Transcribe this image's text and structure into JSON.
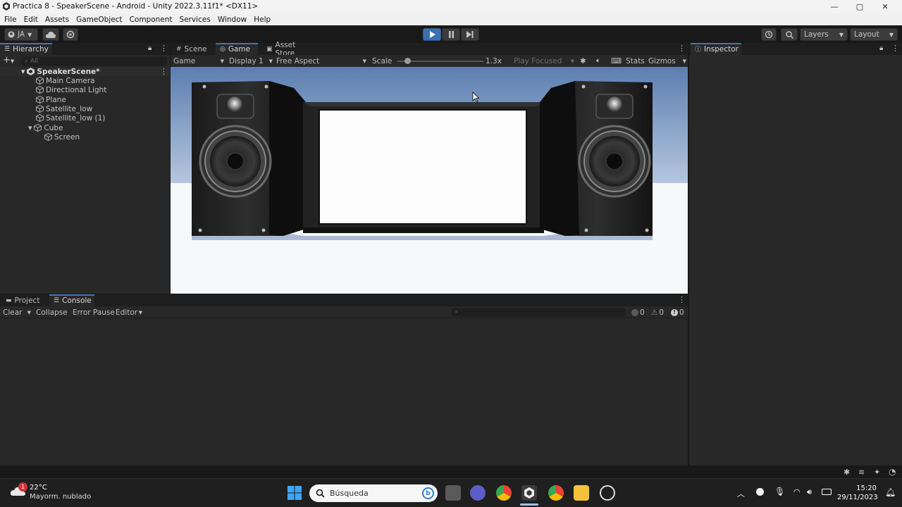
{
  "window": {
    "title": "Practica 8 - SpeakerScene - Android - Unity 2022.3.11f1* <DX11>"
  },
  "menu": [
    "File",
    "Edit",
    "Assets",
    "GameObject",
    "Component",
    "Services",
    "Window",
    "Help"
  ],
  "toolbar": {
    "account": "JA",
    "layers": "Layers",
    "layout": "Layout"
  },
  "hierarchy": {
    "tab": "Hierarchy",
    "search_placeholder": "All",
    "scene": "SpeakerScene*",
    "items": [
      {
        "label": "Main Camera"
      },
      {
        "label": "Directional Light"
      },
      {
        "label": "Plane"
      },
      {
        "label": "Satellite_low"
      },
      {
        "label": "Satellite_low (1)"
      },
      {
        "label": "Cube"
      },
      {
        "label": "Screen"
      }
    ]
  },
  "center_tabs": [
    "Scene",
    "Game",
    "Asset Store"
  ],
  "game_bar": {
    "mode": "Game",
    "display": "Display 1",
    "aspect": "Free Aspect",
    "scale_label": "Scale",
    "scale_value": "1.3x",
    "play_focused": "Play Focused",
    "stats": "Stats",
    "gizmos": "Gizmos"
  },
  "inspector": {
    "tab": "Inspector"
  },
  "bottom_tabs": [
    "Project",
    "Console"
  ],
  "console": {
    "clear": "Clear",
    "collapse": "Collapse",
    "error_pause": "Error Pause",
    "editor": "Editor",
    "log_count": "0",
    "warn_count": "0",
    "error_count": "0"
  },
  "taskbar": {
    "temperature": "22°C",
    "weather": "Mayorm. nublado",
    "search": "Búsqueda",
    "time": "15:20",
    "date": "29/11/2023",
    "notification_badge": "1"
  },
  "colors": {
    "accent": "#3a79bb",
    "play_active": "#3a6fb0"
  }
}
